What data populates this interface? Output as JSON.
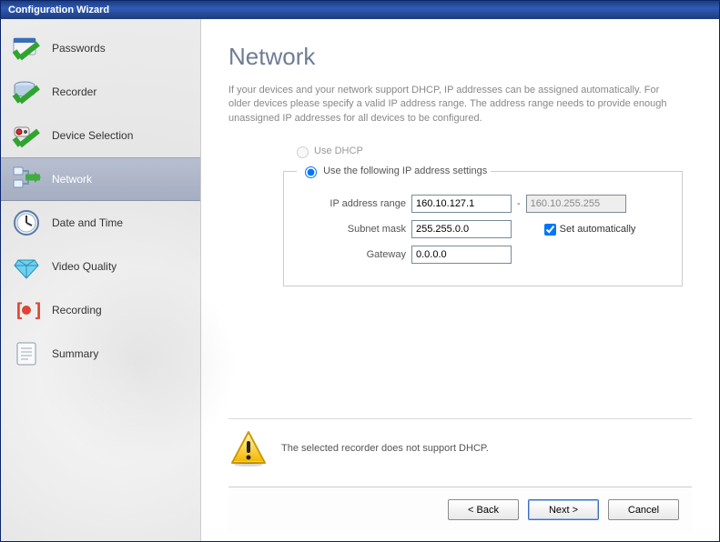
{
  "window": {
    "title": "Configuration Wizard"
  },
  "sidebar": {
    "items": [
      {
        "label": "Passwords",
        "icon": "passwords-icon",
        "done": true,
        "active": false
      },
      {
        "label": "Recorder",
        "icon": "recorder-icon",
        "done": true,
        "active": false
      },
      {
        "label": "Device Selection",
        "icon": "device-selection-icon",
        "done": true,
        "active": false
      },
      {
        "label": "Network",
        "icon": "network-icon",
        "done": false,
        "active": true,
        "activeArrow": true
      },
      {
        "label": "Date and Time",
        "icon": "clock-icon",
        "done": false,
        "active": false
      },
      {
        "label": "Video Quality",
        "icon": "diamond-icon",
        "done": false,
        "active": false
      },
      {
        "label": "Recording",
        "icon": "recording-icon",
        "done": false,
        "active": false
      },
      {
        "label": "Summary",
        "icon": "summary-icon",
        "done": false,
        "active": false
      }
    ]
  },
  "page": {
    "title": "Network",
    "description": "If your devices and your network support DHCP, IP addresses can be assigned automatically. For older devices please specify a valid IP address range. The address range needs to provide enough unassigned IP addresses for all devices to be configured.",
    "options": {
      "dhcp_label": "Use DHCP",
      "dhcp_enabled": false,
      "static_label": "Use the following IP address settings",
      "selected": "static"
    },
    "fields": {
      "ip_range_label": "IP address range",
      "ip_range_start": "160.10.127.1",
      "ip_range_end": "160.10.255.255",
      "subnet_label": "Subnet mask",
      "subnet": "255.255.0.0",
      "gateway_label": "Gateway",
      "gateway": "0.0.0.0",
      "auto_label": "Set automatically",
      "auto_checked": true
    },
    "warning": "The selected recorder does not support DHCP."
  },
  "buttons": {
    "back": "< Back",
    "next": "Next >",
    "cancel": "Cancel"
  }
}
